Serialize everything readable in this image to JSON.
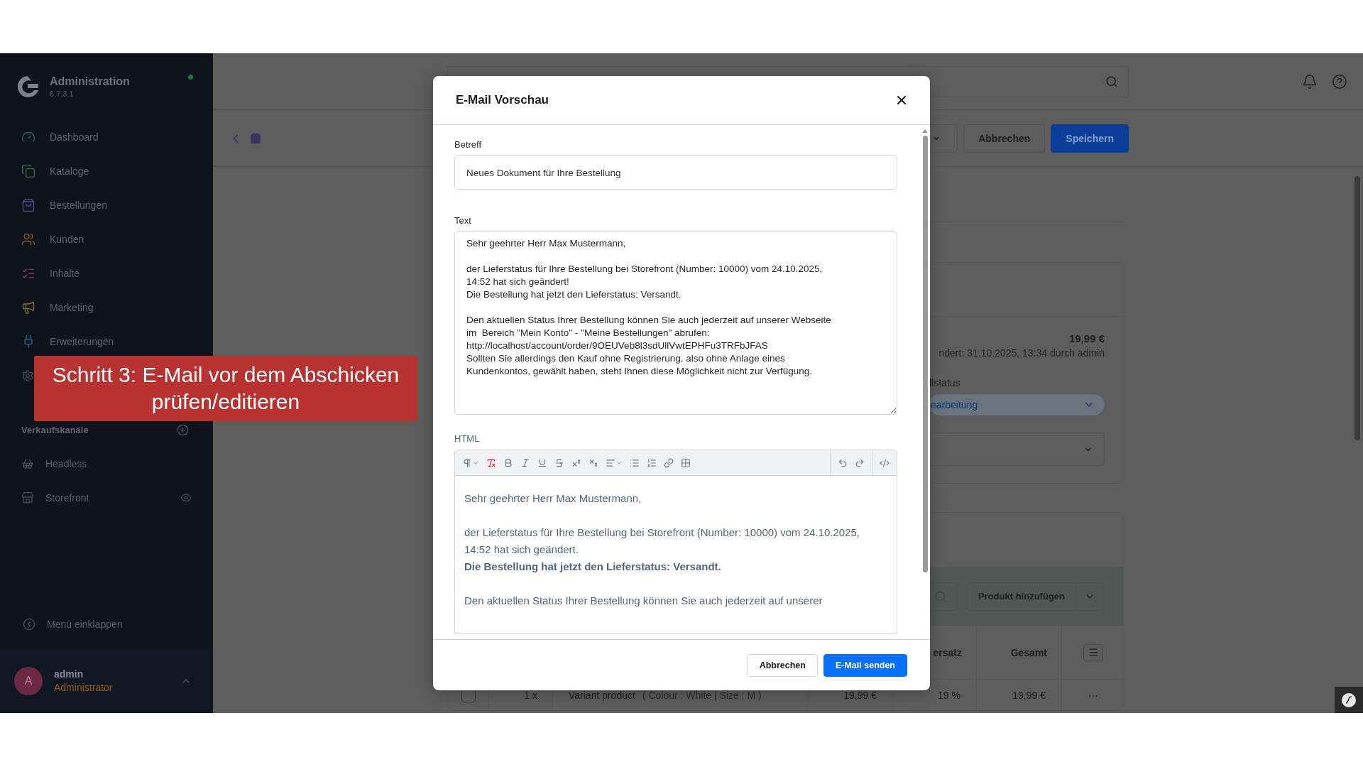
{
  "sidebar": {
    "title": "Administration",
    "version": "6.7.3.1",
    "nav": [
      {
        "label": "Dashboard",
        "kind": "dashboard"
      },
      {
        "label": "Kataloge",
        "kind": "catalog"
      },
      {
        "label": "Bestellungen",
        "kind": "orders"
      },
      {
        "label": "Kunden",
        "kind": "customers"
      },
      {
        "label": "Inhalte",
        "kind": "content"
      },
      {
        "label": "Marketing",
        "kind": "marketing"
      },
      {
        "label": "Erweiterungen",
        "kind": "extensions"
      }
    ],
    "sales_channels": {
      "title": "Verkaufskanäle",
      "items": [
        {
          "label": "Headless",
          "kind": "headless"
        },
        {
          "label": "Storefront",
          "kind": "storefront"
        }
      ]
    },
    "collapse_label": "Menü einklappen",
    "user": {
      "initial": "A",
      "name": "admin",
      "role": "Administrator"
    }
  },
  "smart_bar": {
    "cancel": "Abbrechen",
    "save": "Speichern"
  },
  "order": {
    "total": "19,99 €",
    "changed": "ndert: 31.10.2025, 13:34 durch admin",
    "status_label": "llstatus",
    "status_value": "earbeitung"
  },
  "line_items": {
    "add_button": "Produkt hinzufügen",
    "columns": [
      "ersatz",
      "Gesamt"
    ],
    "rows": [
      {
        "checked": false,
        "quantity": "1 x",
        "product": "Variant product",
        "options": "( Colour : White |  Size : M )",
        "price": "19,99 €",
        "tax": "19 %",
        "total": "19,99 €",
        "actions": "···"
      }
    ]
  },
  "modal": {
    "title": "E-Mail Vorschau",
    "subject_label": "Betreff",
    "subject": "Neues Dokument für Ihre Bestellung",
    "text_label": "Text",
    "text_blocks": [
      [
        "Sehr geehrter Herr Max Mustermann,"
      ],
      [
        "der Lieferstatus für Ihre Bestellung bei Storefront (Number: 10000) vom 24.10.2025,",
        "14:52 hat sich geändert!",
        "Die Bestellung hat jetzt den Lieferstatus: Versandt."
      ],
      [
        "Den aktuellen Status Ihrer Bestellung können Sie auch jederzeit auf unserer Webseite",
        "im  Bereich \"Mein Konto\" - \"Meine Bestellungen\" abrufen:",
        "http://localhost/account/order/9OEUVeb8l3sdUllVwtEPHFu3TRFbJFAS",
        "Sollten Sie allerdings den Kauf ohne Registrierung, also ohne Anlage eines",
        "Kundenkontos, gewählt haben, steht Ihnen diese Möglichkeit nicht zur Verfügung."
      ]
    ],
    "html_label": "HTML",
    "html_paragraphs": [
      [
        "Sehr geehrter Herr Max Mustermann,"
      ],
      [
        "der Lieferstatus für Ihre Bestellung bei Storefront (Number: 10000) vom 24.10.2025, 14:52 hat sich geändert.",
        "**Die Bestellung hat jetzt den Lieferstatus: Versandt.**"
      ],
      [
        "Den aktuellen Status Ihrer Bestellung können Sie auch jederzeit auf unserer"
      ]
    ],
    "buttons": [
      {
        "label": "Abbrechen",
        "kind": "secondary"
      },
      {
        "label": "E-Mail senden",
        "kind": "primary"
      }
    ]
  },
  "callout": {
    "lines": [
      "Schritt 3: E-Mail vor dem Abschicken",
      "prüfen/editieren"
    ]
  }
}
